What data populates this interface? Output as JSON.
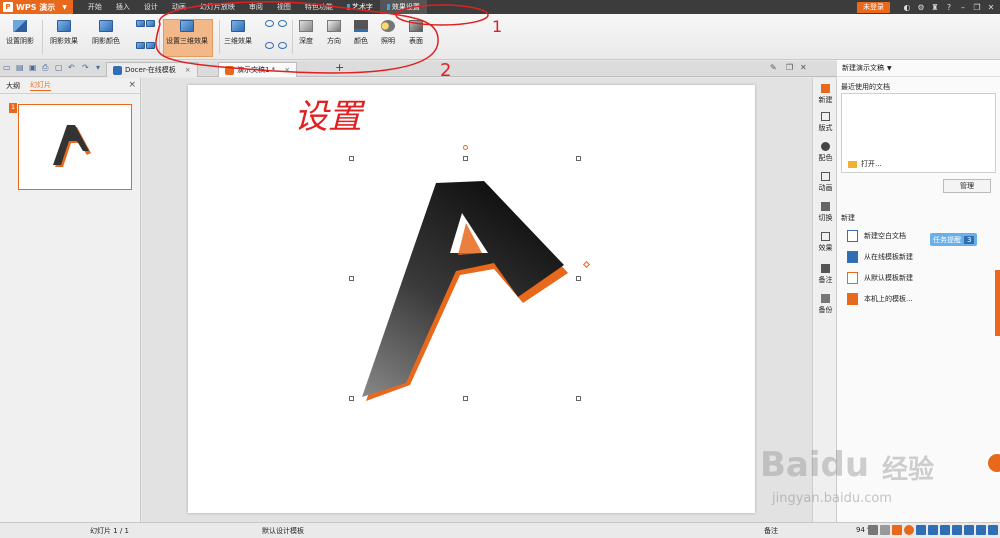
{
  "app": {
    "name": "WPS 演示",
    "logo_letter": "P"
  },
  "menus": [
    "开始",
    "插入",
    "设计",
    "动画",
    "幻灯片放映",
    "审阅",
    "视图",
    "特色功能",
    "艺术字",
    "效果设置"
  ],
  "topbar": {
    "login": "未登录"
  },
  "ribbon": {
    "shadow_set": "设置阴影",
    "shadow_effect": "阴影效果",
    "shadow_color": "阴影颜色",
    "three_d_set": "设置三维效果",
    "three_d_effect": "三维效果",
    "depth": "深度",
    "direction": "方向",
    "color": "颜色",
    "lighting": "照明",
    "surface": "表面"
  },
  "tabs": {
    "docer": "Docer-在线模板",
    "current": "演示文稿1 *",
    "add": "+"
  },
  "leftpanel": {
    "outline": "大纲",
    "slides": "幻灯片",
    "slide_number": "1"
  },
  "slide": {
    "letter": "A"
  },
  "annotations": {
    "num1": "1",
    "num2": "2",
    "word": "设置"
  },
  "rightstrip": [
    "新建",
    "版式",
    "配色",
    "动画",
    "切换",
    "效果",
    "备注",
    "备份"
  ],
  "taskpane": {
    "title": "新建演示文稿",
    "recent": "最近使用的文档",
    "open": "打开...",
    "manage": "管理",
    "new_section": "新建",
    "items": [
      "新建空白文档",
      "从在线模板新建",
      "从默认模板新建",
      "本机上的模板..."
    ],
    "task_badge": "任务提醒",
    "task_count": "3"
  },
  "statusbar": {
    "slide_pos": "幻灯片 1 / 1",
    "template": "默认设计模板",
    "notes": "备注",
    "zoom": "94 %"
  },
  "watermark": {
    "brand": "Baidu",
    "brand_cn": "经验",
    "url": "jingyan.baidu.com"
  },
  "colors": {
    "accent": "#e8681c",
    "annotation": "#e02020"
  }
}
